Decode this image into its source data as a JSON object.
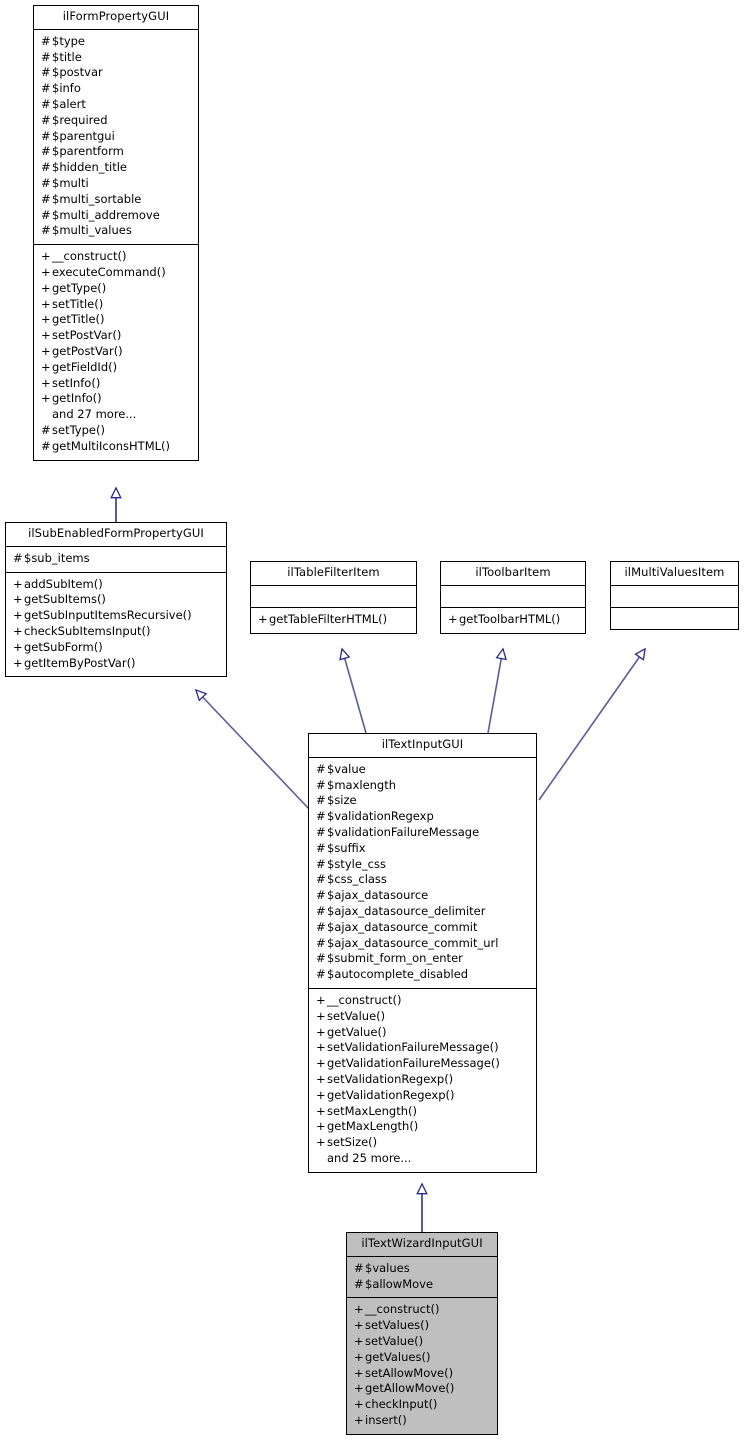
{
  "diagram": {
    "kind": "uml-class-inheritance-diagram",
    "line_color": "#5c5c99",
    "arrowhead_outline_color": "#2a2a8c",
    "highlight_fill": "#bfbfbf",
    "box_border": "#000000",
    "background": "#ffffff"
  },
  "classes": [
    {
      "id": "ilFormPropertyGUI",
      "name": "ilFormPropertyGUI",
      "highlighted": false,
      "attributes": [
        {
          "visibility": "#",
          "label": "$type"
        },
        {
          "visibility": "#",
          "label": "$title"
        },
        {
          "visibility": "#",
          "label": "$postvar"
        },
        {
          "visibility": "#",
          "label": "$info"
        },
        {
          "visibility": "#",
          "label": "$alert"
        },
        {
          "visibility": "#",
          "label": "$required"
        },
        {
          "visibility": "#",
          "label": "$parentgui"
        },
        {
          "visibility": "#",
          "label": "$parentform"
        },
        {
          "visibility": "#",
          "label": "$hidden_title"
        },
        {
          "visibility": "#",
          "label": "$multi"
        },
        {
          "visibility": "#",
          "label": "$multi_sortable"
        },
        {
          "visibility": "#",
          "label": "$multi_addremove"
        },
        {
          "visibility": "#",
          "label": "$multi_values"
        }
      ],
      "methods": [
        {
          "visibility": "+",
          "label": "__construct()"
        },
        {
          "visibility": "+",
          "label": "executeCommand()"
        },
        {
          "visibility": "+",
          "label": "getType()"
        },
        {
          "visibility": "+",
          "label": "setTitle()"
        },
        {
          "visibility": "+",
          "label": "getTitle()"
        },
        {
          "visibility": "+",
          "label": "setPostVar()"
        },
        {
          "visibility": "+",
          "label": "getPostVar()"
        },
        {
          "visibility": "+",
          "label": "getFieldId()"
        },
        {
          "visibility": "+",
          "label": "setInfo()"
        },
        {
          "visibility": "+",
          "label": "getInfo()"
        },
        {
          "visibility": "",
          "label": "and 27 more..."
        },
        {
          "visibility": "#",
          "label": "setType()"
        },
        {
          "visibility": "#",
          "label": "getMultiIconsHTML()"
        }
      ]
    },
    {
      "id": "ilSubEnabledFormPropertyGUI",
      "name": "ilSubEnabledFormPropertyGUI",
      "highlighted": false,
      "attributes": [
        {
          "visibility": "#",
          "label": "$sub_items"
        }
      ],
      "methods": [
        {
          "visibility": "+",
          "label": "addSubItem()"
        },
        {
          "visibility": "+",
          "label": "getSubItems()"
        },
        {
          "visibility": "+",
          "label": "getSubInputItemsRecursive()"
        },
        {
          "visibility": "+",
          "label": "checkSubItemsInput()"
        },
        {
          "visibility": "+",
          "label": "getSubForm()"
        },
        {
          "visibility": "+",
          "label": "getItemByPostVar()"
        }
      ]
    },
    {
      "id": "ilTableFilterItem",
      "name": "ilTableFilterItem",
      "highlighted": false,
      "attributes": [],
      "methods": [
        {
          "visibility": "+",
          "label": "getTableFilterHTML()"
        }
      ]
    },
    {
      "id": "ilToolbarItem",
      "name": "ilToolbarItem",
      "highlighted": false,
      "attributes": [],
      "methods": [
        {
          "visibility": "+",
          "label": "getToolbarHTML()"
        }
      ]
    },
    {
      "id": "ilMultiValuesItem",
      "name": "ilMultiValuesItem",
      "highlighted": false,
      "attributes": [],
      "methods": []
    },
    {
      "id": "ilTextInputGUI",
      "name": "ilTextInputGUI",
      "highlighted": false,
      "attributes": [
        {
          "visibility": "#",
          "label": "$value"
        },
        {
          "visibility": "#",
          "label": "$maxlength"
        },
        {
          "visibility": "#",
          "label": "$size"
        },
        {
          "visibility": "#",
          "label": "$validationRegexp"
        },
        {
          "visibility": "#",
          "label": "$validationFailureMessage"
        },
        {
          "visibility": "#",
          "label": "$suffix"
        },
        {
          "visibility": "#",
          "label": "$style_css"
        },
        {
          "visibility": "#",
          "label": "$css_class"
        },
        {
          "visibility": "#",
          "label": "$ajax_datasource"
        },
        {
          "visibility": "#",
          "label": "$ajax_datasource_delimiter"
        },
        {
          "visibility": "#",
          "label": "$ajax_datasource_commit"
        },
        {
          "visibility": "#",
          "label": "$ajax_datasource_commit_url"
        },
        {
          "visibility": "#",
          "label": "$submit_form_on_enter"
        },
        {
          "visibility": "#",
          "label": "$autocomplete_disabled"
        }
      ],
      "methods": [
        {
          "visibility": "+",
          "label": "__construct()"
        },
        {
          "visibility": "+",
          "label": "setValue()"
        },
        {
          "visibility": "+",
          "label": "getValue()"
        },
        {
          "visibility": "+",
          "label": "setValidationFailureMessage()"
        },
        {
          "visibility": "+",
          "label": "getValidationFailureMessage()"
        },
        {
          "visibility": "+",
          "label": "setValidationRegexp()"
        },
        {
          "visibility": "+",
          "label": "getValidationRegexp()"
        },
        {
          "visibility": "+",
          "label": "setMaxLength()"
        },
        {
          "visibility": "+",
          "label": "getMaxLength()"
        },
        {
          "visibility": "+",
          "label": "setSize()"
        },
        {
          "visibility": "",
          "label": "and 25 more..."
        }
      ]
    },
    {
      "id": "ilTextWizardInputGUI",
      "name": "ilTextWizardInputGUI",
      "highlighted": true,
      "attributes": [
        {
          "visibility": "#",
          "label": "$values"
        },
        {
          "visibility": "#",
          "label": "$allowMove"
        }
      ],
      "methods": [
        {
          "visibility": "+",
          "label": "__construct()"
        },
        {
          "visibility": "+",
          "label": "setValues()"
        },
        {
          "visibility": "+",
          "label": "setValue()"
        },
        {
          "visibility": "+",
          "label": "getValues()"
        },
        {
          "visibility": "+",
          "label": "setAllowMove()"
        },
        {
          "visibility": "+",
          "label": "getAllowMove()"
        },
        {
          "visibility": "+",
          "label": "checkInput()"
        },
        {
          "visibility": "+",
          "label": "insert()"
        }
      ]
    }
  ],
  "relations": [
    {
      "type": "generalization",
      "from": "ilSubEnabledFormPropertyGUI",
      "to": "ilFormPropertyGUI"
    },
    {
      "type": "generalization",
      "from": "ilTextInputGUI",
      "to": "ilSubEnabledFormPropertyGUI"
    },
    {
      "type": "generalization",
      "from": "ilTextInputGUI",
      "to": "ilTableFilterItem"
    },
    {
      "type": "generalization",
      "from": "ilTextInputGUI",
      "to": "ilToolbarItem"
    },
    {
      "type": "generalization",
      "from": "ilTextInputGUI",
      "to": "ilMultiValuesItem"
    },
    {
      "type": "generalization",
      "from": "ilTextWizardInputGUI",
      "to": "ilTextInputGUI"
    }
  ]
}
